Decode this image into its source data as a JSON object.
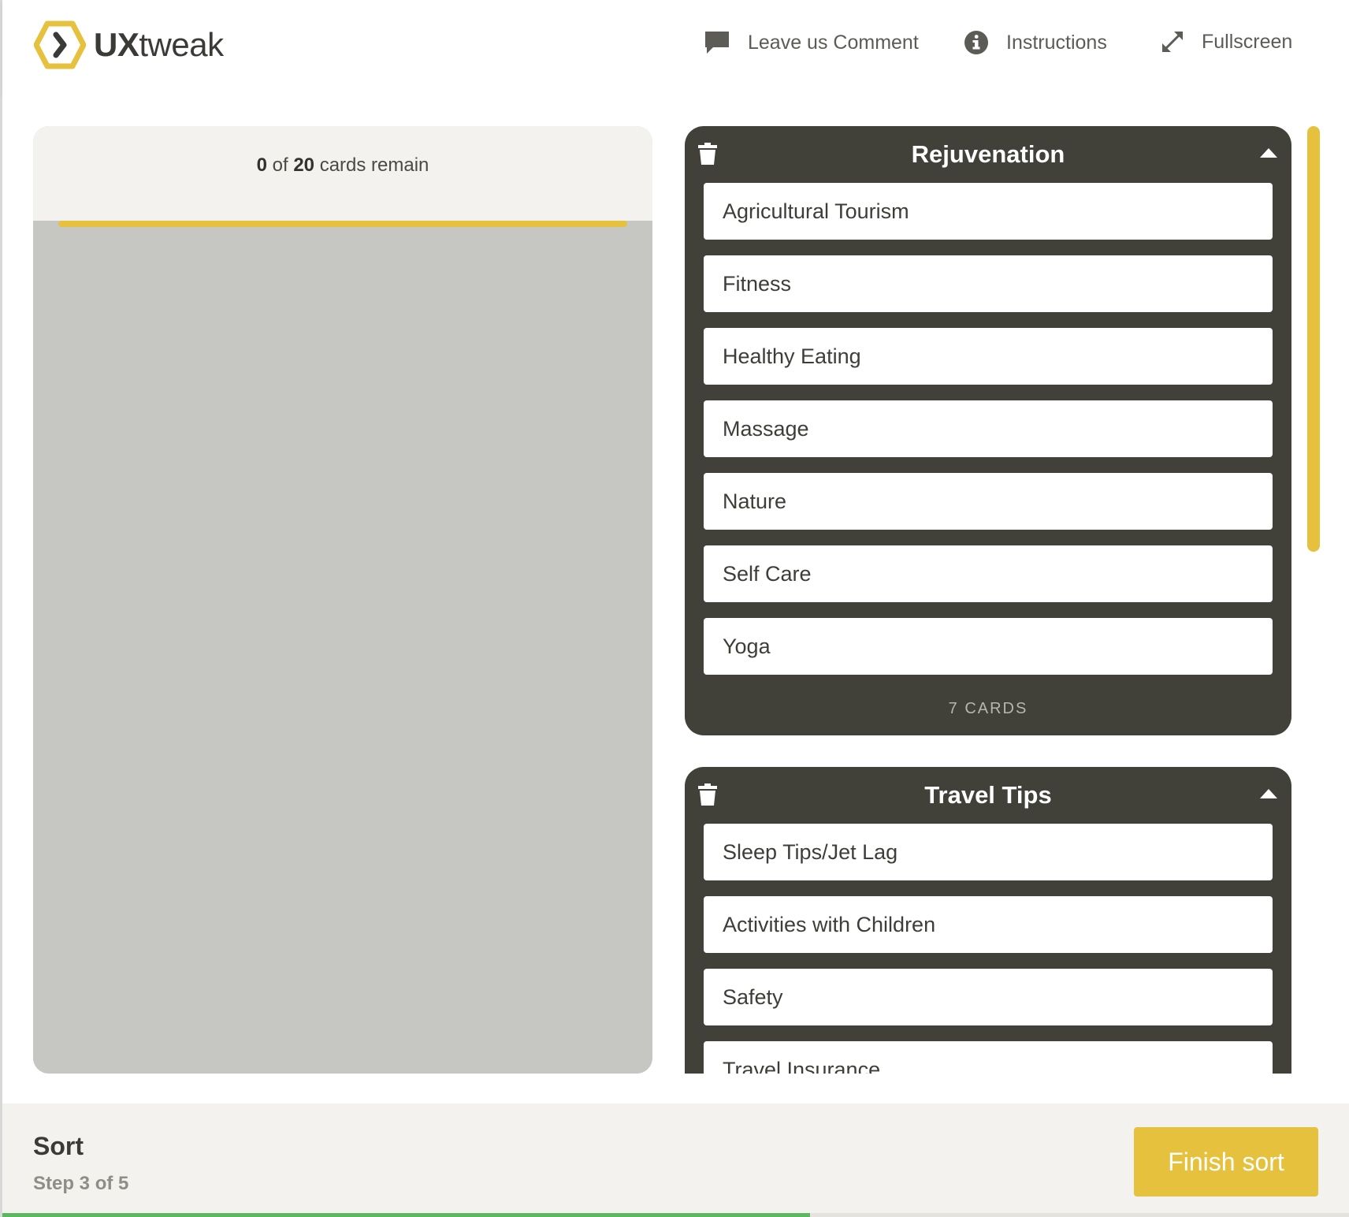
{
  "header": {
    "logo_text_bold": "UX",
    "logo_text_rest": "tweak",
    "nav": {
      "comment": "Leave us Comment",
      "instructions": "Instructions",
      "fullscreen": "Fullscreen"
    }
  },
  "pile": {
    "remaining": "0",
    "of_label": "of",
    "total": "20",
    "suffix": "cards remain"
  },
  "categories": [
    {
      "title": "Rejuvenation",
      "cards": [
        "Agricultural Tourism",
        "Fitness",
        "Healthy Eating",
        "Massage",
        "Nature",
        "Self Care",
        "Yoga"
      ],
      "count_label": "7 CARDS"
    },
    {
      "title": "Travel Tips",
      "cards": [
        "Sleep Tips/Jet Lag",
        "Activities with Children",
        "Safety",
        "Travel Insurance"
      ],
      "count_label": ""
    }
  ],
  "footer": {
    "title": "Sort",
    "step": "Step 3 of 5",
    "finish_label": "Finish sort",
    "progress_fraction": 0.6
  },
  "colors": {
    "accent": "#e6c13e",
    "category_bg": "#41413a",
    "progress": "#5cb85c"
  },
  "icons": {
    "logo": "hexagon-chevron-icon",
    "comment": "speech-bubble-icon",
    "instructions": "info-icon",
    "fullscreen": "expand-arrows-icon",
    "delete": "trash-icon",
    "collapse": "caret-up-icon"
  }
}
